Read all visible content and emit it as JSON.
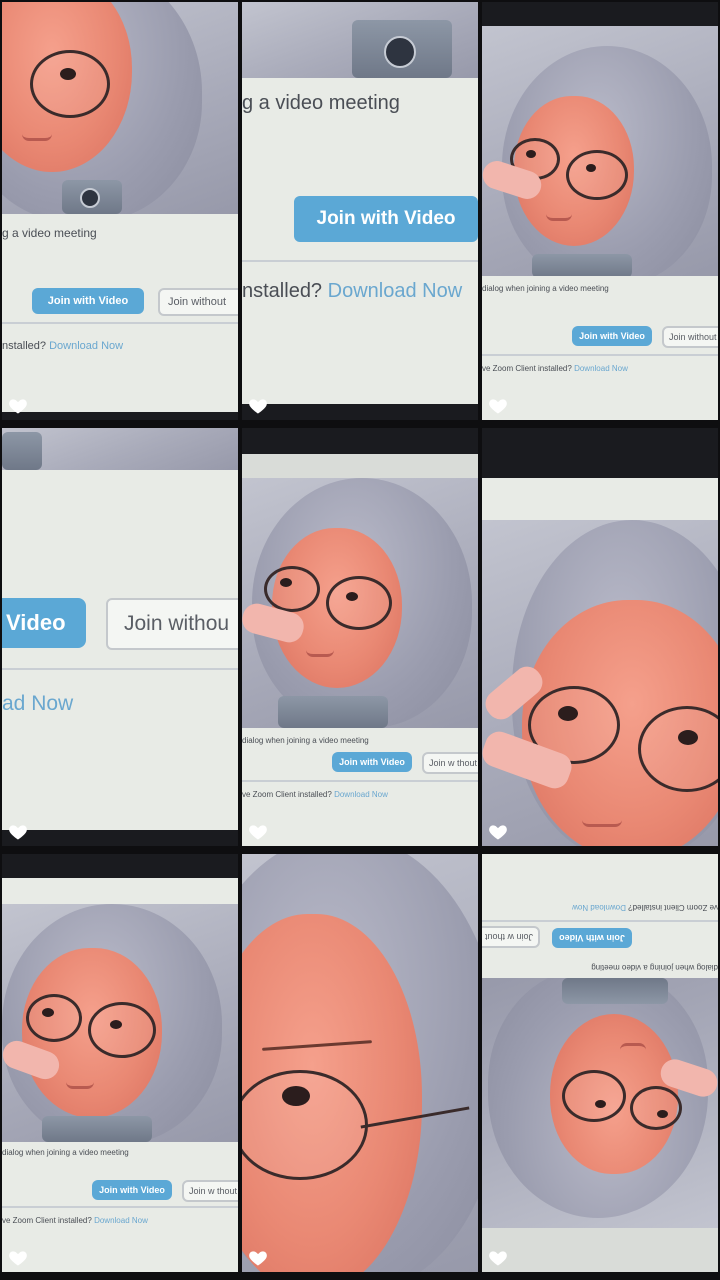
{
  "texts": {
    "meeting_prefix": "g a video meeting",
    "dialog_line": "dialog when joining a video meeting",
    "join_video": "Join with Video",
    "join_without": "Join without",
    "join_without_cut": "Join withou",
    "join_without_short": "Join w thout",
    "video_cut": "Video",
    "installed_full": "ve Zoom Client installed?",
    "installed_short": "nstalled?",
    "download_now": "Download Now",
    "download_cut": "ad Now"
  },
  "icons": {
    "like": "heart-icon"
  },
  "colors": {
    "button_blue": "#5ba8d6",
    "link_blue": "#6aa7cf",
    "heart": "#ffffff"
  }
}
